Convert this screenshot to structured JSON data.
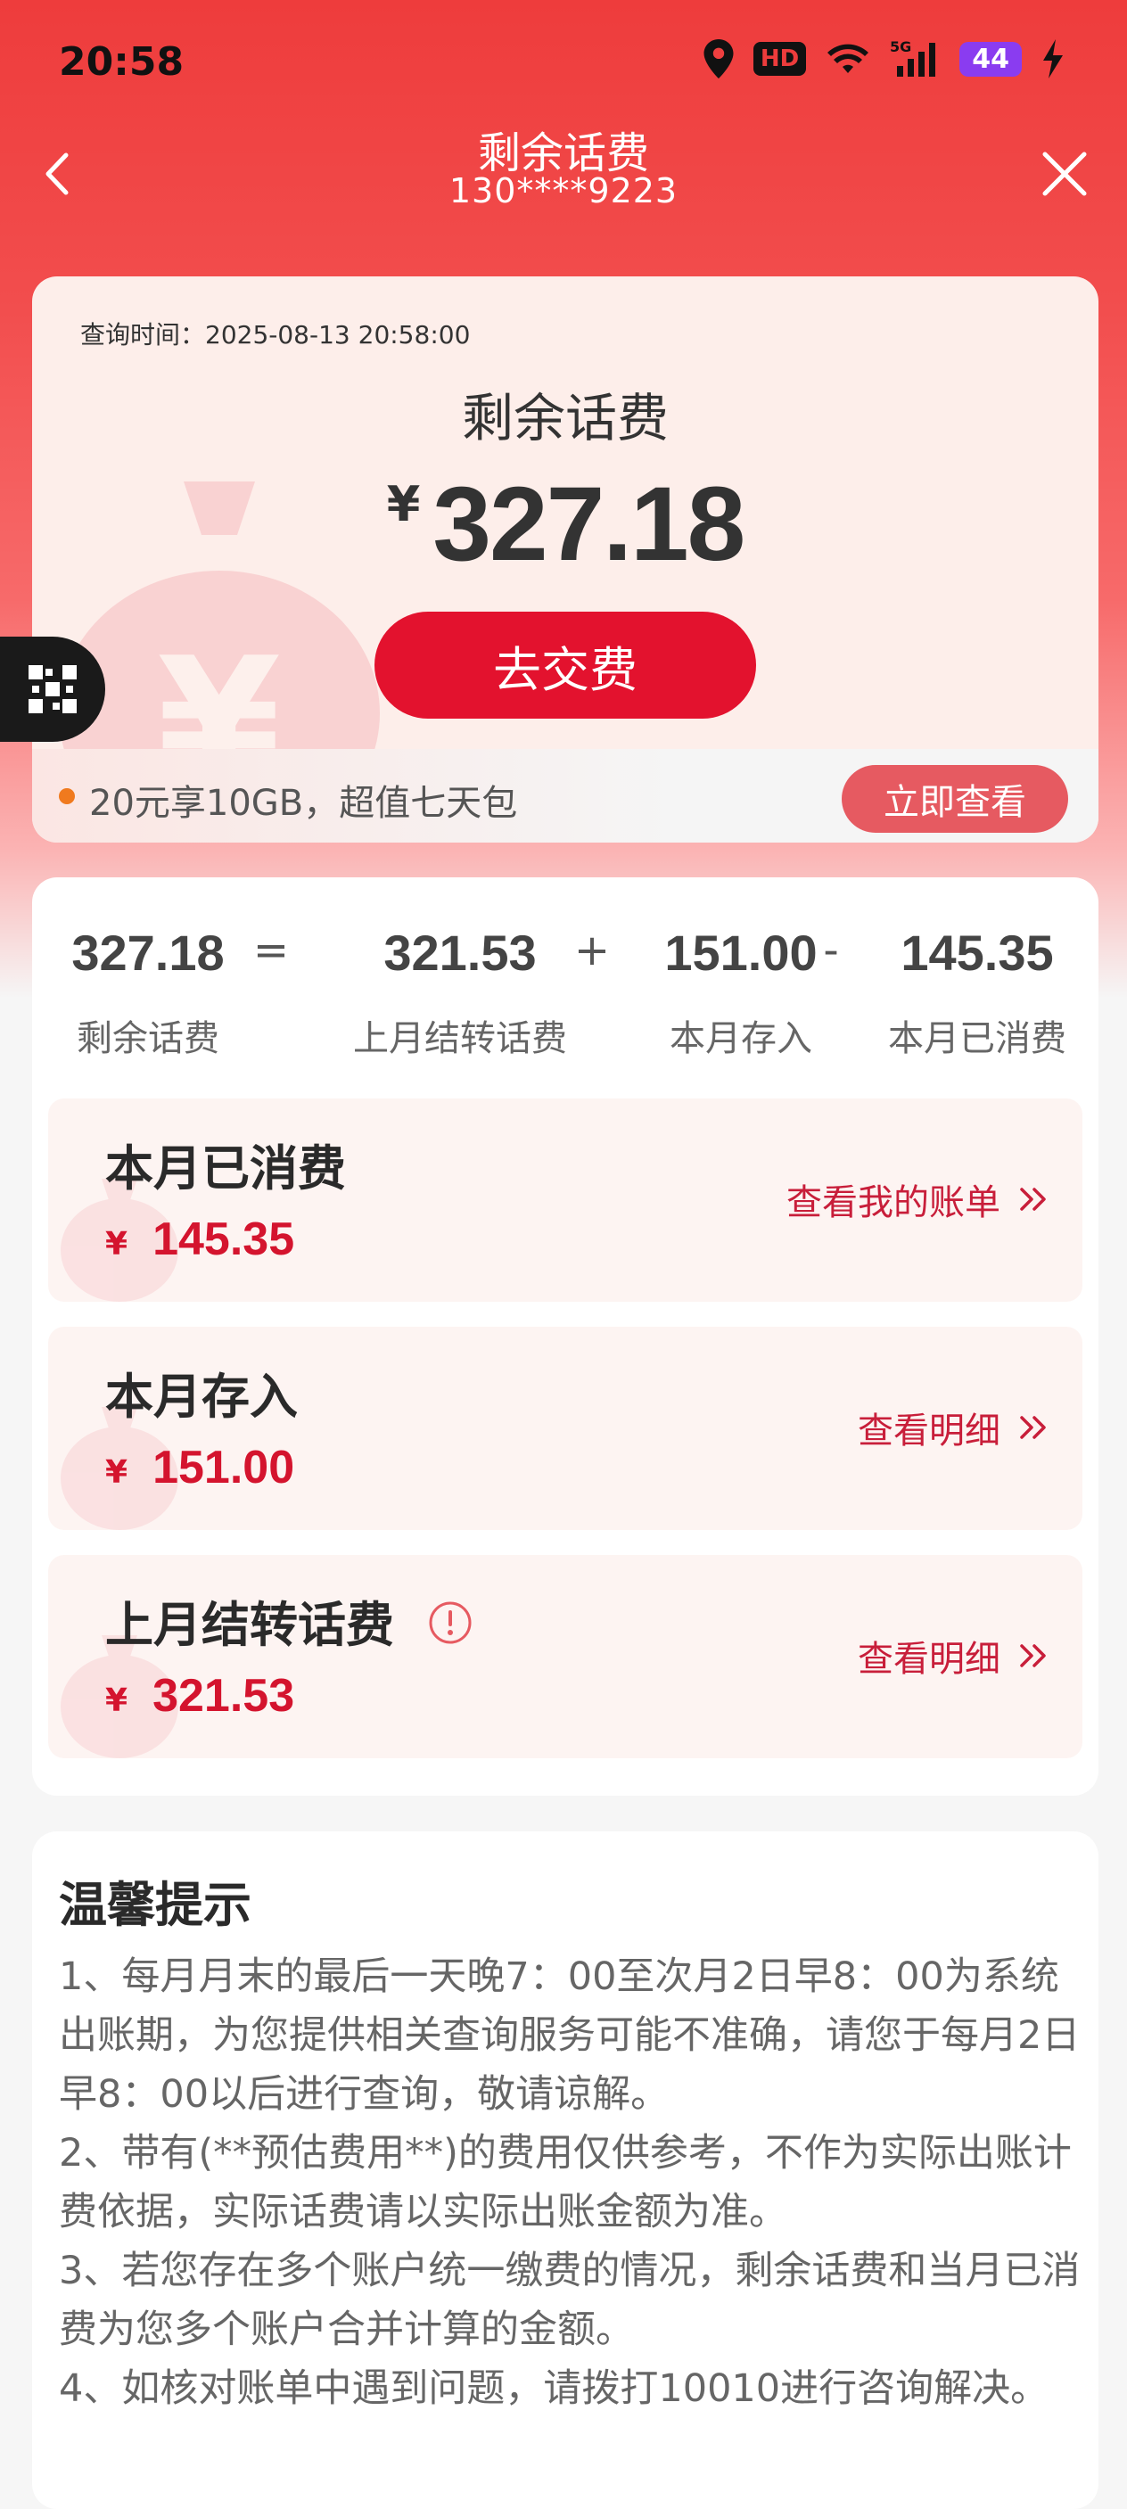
{
  "status_bar": {
    "time": "20:58",
    "battery": "44"
  },
  "nav": {
    "title": "剩余话费",
    "phone": "130****9223"
  },
  "balance_card": {
    "query_time": "查询时间：2025-08-13 20:58:00",
    "label": "剩余话费",
    "currency": "¥",
    "amount": "327.18",
    "pay_button": "去交费",
    "promo_text": "20元享10GB，超值七天包",
    "promo_button": "立即查看"
  },
  "summary": {
    "equation": [
      {
        "value": "327.18",
        "label": "剩余话费"
      },
      {
        "value": "321.53",
        "label": "上月结转话费"
      },
      {
        "value": "151.00",
        "label": "本月存入"
      },
      {
        "value": "145.35",
        "label": "本月已消费"
      }
    ],
    "operators": [
      "=",
      "+",
      "-"
    ],
    "rows": [
      {
        "title": "本月已消费",
        "currency": "¥",
        "amount": "145.35",
        "link": "查看我的账单"
      },
      {
        "title": "本月存入",
        "currency": "¥",
        "amount": "151.00",
        "link": "查看明细"
      },
      {
        "title": "上月结转话费",
        "currency": "¥",
        "amount": "321.53",
        "link": "查看明细"
      }
    ]
  },
  "tips": {
    "title": "温馨提示",
    "items": [
      "1、每月月末的最后一天晚7：00至次月2日早8：00为系统出账期，为您提供相关查询服务可能不准确，请您于每月2日早8：00以后进行查询，敬请谅解。",
      "2、带有(**预估费用**)的费用仅供参考，不作为实际出账计费依据，实际话费请以实际出账金额为准。",
      "3、若您存在多个账户统一缴费的情况，剩余话费和当月已消费为您多个账户合并计算的金额。",
      "4、如核对账单中遇到问题，请拨打10010进行咨询解决。"
    ]
  },
  "colors": {
    "brand_red": "#e3122e",
    "accent_red": "#d4142e",
    "link_red": "#c81e3a"
  },
  "icons": [
    "location-icon",
    "hd-icon",
    "wifi-icon",
    "signal-5g-icon",
    "charging-icon",
    "back-icon",
    "close-icon",
    "qr-float-icon",
    "double-chevron-right-icon",
    "info-icon"
  ]
}
